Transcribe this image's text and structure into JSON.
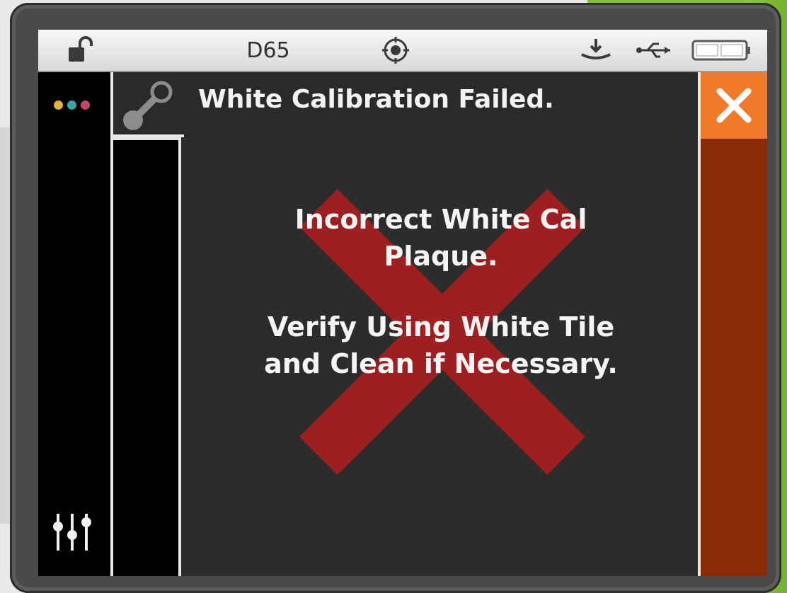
{
  "status_bar": {
    "illuminant": "D65",
    "icons": [
      "unlock-icon",
      "target-icon",
      "tray-download-icon",
      "usb-icon",
      "battery-icon"
    ]
  },
  "sidebar": {
    "dot_colors": [
      "#e2b13c",
      "#3aa7a5",
      "#c3476b"
    ],
    "icons": [
      "menu-dots-icon",
      "sliders-icon"
    ]
  },
  "dialog": {
    "title": "White Calibration Failed.",
    "message_line_1": "Incorrect White Cal",
    "message_line_2": "Plaque.",
    "message_line_3": "Verify Using White Tile",
    "message_line_4": "and Clean if Necessary.",
    "icons": [
      "probe-icon",
      "error-x-icon"
    ]
  },
  "close_button": {
    "icon": "close-icon",
    "color": "#f07a2a"
  },
  "colors": {
    "error_x": "#9e1f22",
    "right_column": "#8a2a06",
    "content_bg": "#2c2c2c"
  }
}
